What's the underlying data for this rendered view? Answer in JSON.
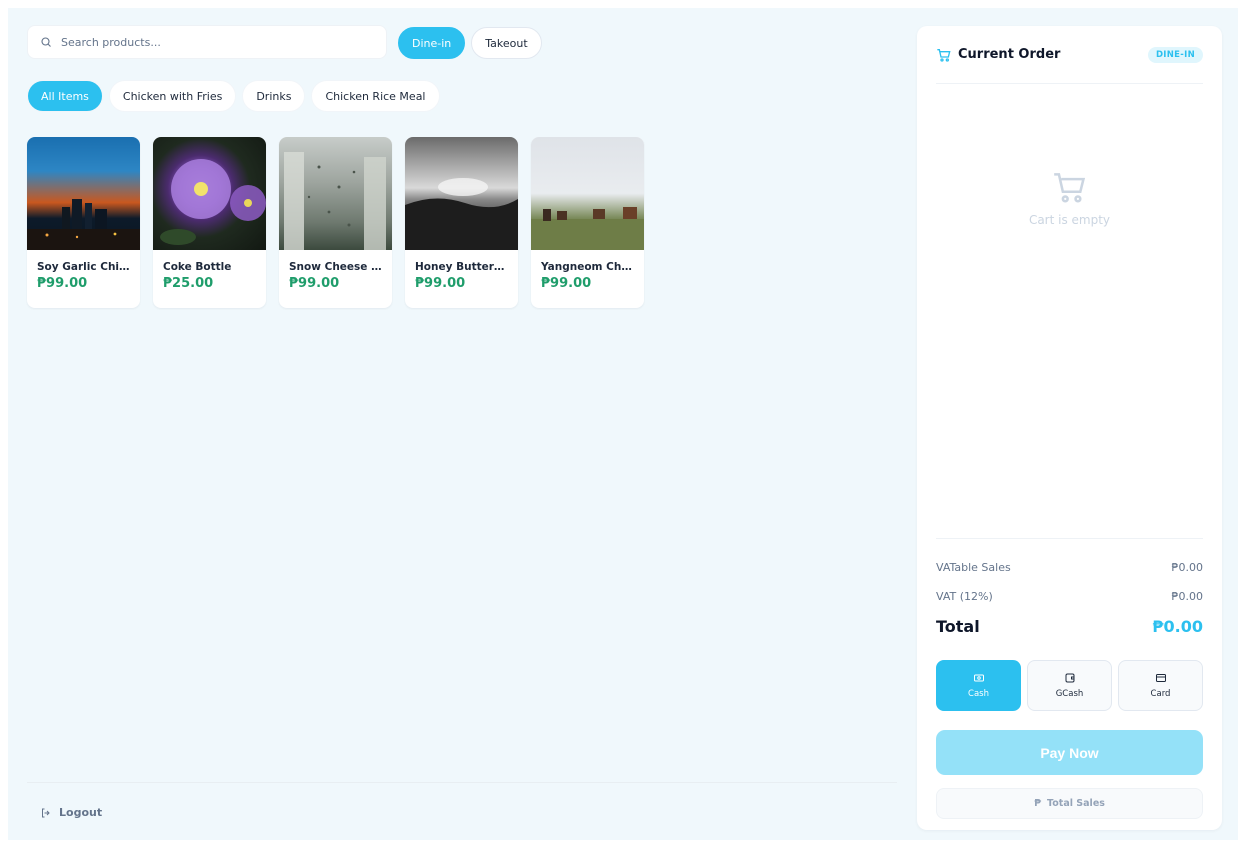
{
  "search": {
    "placeholder": "Search products..."
  },
  "order_type": {
    "dine_in": "Dine-in",
    "takeout": "Takeout",
    "selected": "Dine-in"
  },
  "categories": [
    {
      "label": "All Items",
      "active": true
    },
    {
      "label": "Chicken with Fries",
      "active": false
    },
    {
      "label": "Drinks",
      "active": false
    },
    {
      "label": "Chicken Rice Meal",
      "active": false
    }
  ],
  "products": [
    {
      "name": "Soy Garlic Chic...",
      "price": "₱99.00",
      "image": "city-sunset-photo"
    },
    {
      "name": "Coke Bottle",
      "price": "₱25.00",
      "image": "purple-flower-photo"
    },
    {
      "name": "Snow Cheese ...",
      "price": "₱99.00",
      "image": "rainy-window-photo"
    },
    {
      "name": "Honey Butter C...",
      "price": "₱99.00",
      "image": "bw-landscape-photo"
    },
    {
      "name": "Yangneom Chi...",
      "price": "₱99.00",
      "image": "horses-field-photo"
    }
  ],
  "footer": {
    "logout": "Logout"
  },
  "order": {
    "title": "Current Order",
    "badge": "DINE-IN",
    "empty_text": "Cart is empty",
    "vatable_label": "VATable Sales",
    "vatable_value": "₱0.00",
    "vat_label": "VAT (12%)",
    "vat_value": "₱0.00",
    "total_label": "Total",
    "total_value": "₱0.00",
    "methods": [
      {
        "label": "Cash",
        "icon": "cash-icon",
        "active": true
      },
      {
        "label": "GCash",
        "icon": "wallet-icon",
        "active": false
      },
      {
        "label": "Card",
        "icon": "card-icon",
        "active": false
      }
    ],
    "pay_now": "Pay Now",
    "total_sales": "Total Sales"
  },
  "colors": {
    "accent": "#2cc0ef",
    "price": "#1f9d6b",
    "background": "#f0f8fc"
  }
}
